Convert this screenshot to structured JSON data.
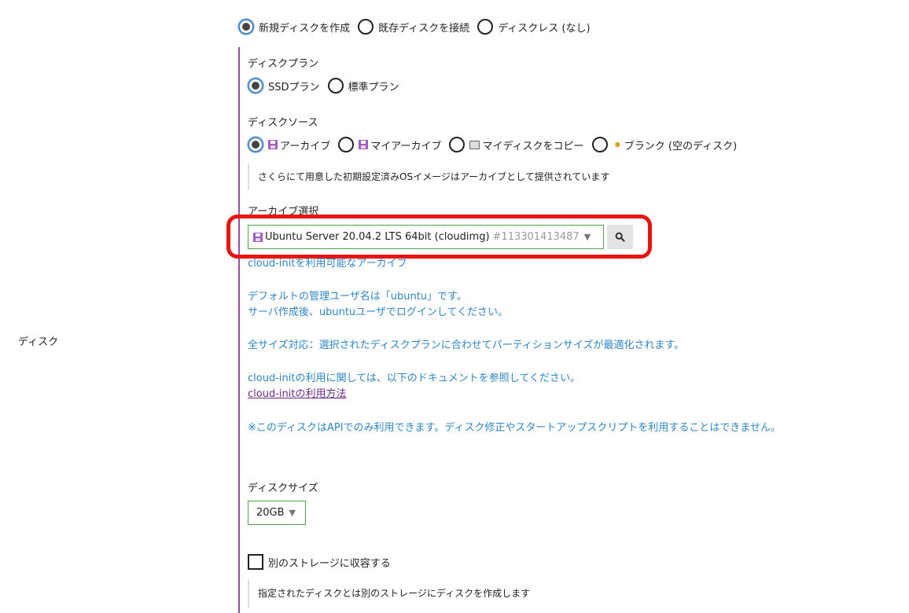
{
  "disk": {
    "row_label": "ディスク",
    "mode_options": [
      {
        "label": "新規ディスクを作成",
        "checked": true
      },
      {
        "label": "既存ディスクを接続",
        "checked": false
      },
      {
        "label": "ディスクレス (なし)",
        "checked": false
      }
    ],
    "plan": {
      "title": "ディスクプラン",
      "options": [
        {
          "label": "SSDプラン",
          "checked": true
        },
        {
          "label": "標準プラン",
          "checked": false
        }
      ]
    },
    "source": {
      "title": "ディスクソース",
      "options": [
        {
          "label": "アーカイブ",
          "icon": "floppy-disk-icon",
          "checked": true
        },
        {
          "label": "マイアーカイブ",
          "icon": "floppy-disk-icon",
          "checked": false
        },
        {
          "label": "マイディスクをコピー",
          "icon": "disk-drive-icon",
          "checked": false
        },
        {
          "label": "ブランク (空のディスク)",
          "icon": "sparkle-icon",
          "checked": false
        }
      ],
      "note": "さくらにて用意した初期設定済みOSイメージはアーカイブとして提供されています"
    },
    "archive": {
      "title": "アーカイブ選択",
      "selected_name": "Ubuntu Server 20.04.2 LTS 64bit (cloudimg)",
      "selected_id": "#113301413487",
      "info_lines": [
        "cloud-initを利用可能なアーカイブ",
        "デフォルトの管理ユーザ名は「ubuntu」です。",
        "サーバ作成後、ubuntuユーザでログインしてください。",
        "全サイズ対応：選択されたディスクプランに合わせてパーティションサイズが最適化されます。",
        "cloud-initの利用に関しては、以下のドキュメントを参照してください。",
        "※このディスクはAPIでのみ利用できます。ディスク修正やスタートアップスクリプトを利用することはできません。"
      ],
      "doc_link": "cloud-initの利用方法"
    },
    "size": {
      "title": "ディスクサイズ",
      "value": "20GB"
    },
    "storage": {
      "checkbox_label": "別のストレージに収容する",
      "checked": false,
      "note": "指定されたディスクとは別のストレージにディスクを作成します"
    }
  },
  "colors": {
    "accent_bar": "#9d4f9a",
    "info_text": "#2f86c5",
    "link": "#6b2a8a",
    "select_border": "#4ca34c",
    "highlight": "#e8140f"
  }
}
